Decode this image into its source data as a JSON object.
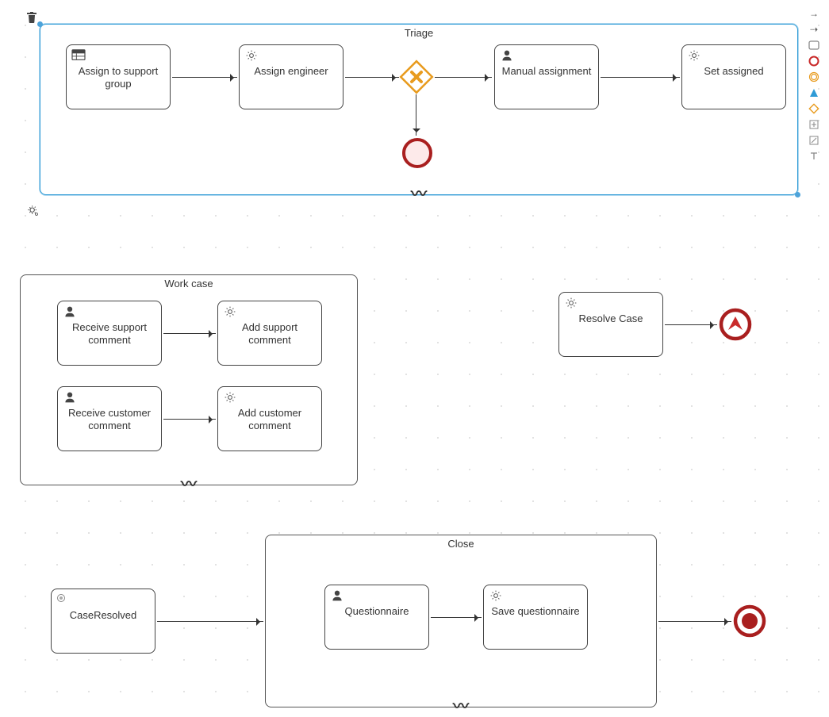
{
  "subprocesses": {
    "triage": {
      "title": "Triage"
    },
    "workcase": {
      "title": "Work case"
    },
    "close": {
      "title": "Close"
    }
  },
  "tasks": {
    "assign_support_group": "Assign to support group",
    "assign_engineer": "Assign engineer",
    "manual_assignment": "Manual assignment",
    "set_assigned": "Set assigned",
    "receive_support_comment": "Receive support comment",
    "add_support_comment": "Add support comment",
    "receive_customer_comment": "Receive customer comment",
    "add_customer_comment": "Add customer comment",
    "resolve_case": "Resolve Case",
    "case_resolved": "CaseResolved",
    "questionnaire": "Questionnaire",
    "save_questionnaire": "Save questionnaire"
  },
  "palette": {
    "arrow1": "→",
    "arrow2": "⇢"
  },
  "chart_data": {
    "type": "bpmn-diagram",
    "subprocesses": [
      {
        "id": "triage",
        "label": "Triage",
        "adhoc": true,
        "selected": true,
        "nodes": [
          {
            "id": "assign_support_group",
            "type": "business-rule-task",
            "label": "Assign to support group"
          },
          {
            "id": "assign_engineer",
            "type": "service-task",
            "label": "Assign engineer"
          },
          {
            "id": "gw_cancel",
            "type": "exclusive-gateway-cancel"
          },
          {
            "id": "manual_assignment",
            "type": "user-task",
            "label": "Manual assignment"
          },
          {
            "id": "set_assigned",
            "type": "service-task",
            "label": "Set assigned"
          },
          {
            "id": "end_err",
            "type": "error-end-event"
          }
        ],
        "flows": [
          [
            "assign_support_group",
            "assign_engineer"
          ],
          [
            "assign_engineer",
            "gw_cancel"
          ],
          [
            "gw_cancel",
            "manual_assignment"
          ],
          [
            "manual_assignment",
            "set_assigned"
          ],
          [
            "gw_cancel",
            "end_err"
          ]
        ]
      },
      {
        "id": "workcase",
        "label": "Work case",
        "adhoc": true,
        "nodes": [
          {
            "id": "receive_support_comment",
            "type": "user-task",
            "label": "Receive support comment"
          },
          {
            "id": "add_support_comment",
            "type": "service-task",
            "label": "Add support comment"
          },
          {
            "id": "receive_customer_comment",
            "type": "user-task",
            "label": "Receive customer comment"
          },
          {
            "id": "add_customer_comment",
            "type": "service-task",
            "label": "Add customer comment"
          }
        ],
        "flows": [
          [
            "receive_support_comment",
            "add_support_comment"
          ],
          [
            "receive_customer_comment",
            "add_customer_comment"
          ]
        ]
      },
      {
        "id": "close",
        "label": "Close",
        "adhoc": true,
        "nodes": [
          {
            "id": "questionnaire",
            "type": "user-task",
            "label": "Questionnaire"
          },
          {
            "id": "save_questionnaire",
            "type": "service-task",
            "label": "Save questionnaire"
          }
        ],
        "flows": [
          [
            "questionnaire",
            "save_questionnaire"
          ]
        ]
      }
    ],
    "top_level_nodes": [
      {
        "id": "resolve_case",
        "type": "service-task",
        "label": "Resolve Case"
      },
      {
        "id": "esc_evt",
        "type": "escalation-end-event"
      },
      {
        "id": "case_resolved",
        "type": "task",
        "label": "CaseResolved"
      },
      {
        "id": "term_evt",
        "type": "terminate-end-event"
      }
    ],
    "top_level_flows": [
      [
        "resolve_case",
        "esc_evt"
      ],
      [
        "case_resolved",
        "close"
      ],
      [
        "close",
        "term_evt"
      ]
    ]
  }
}
